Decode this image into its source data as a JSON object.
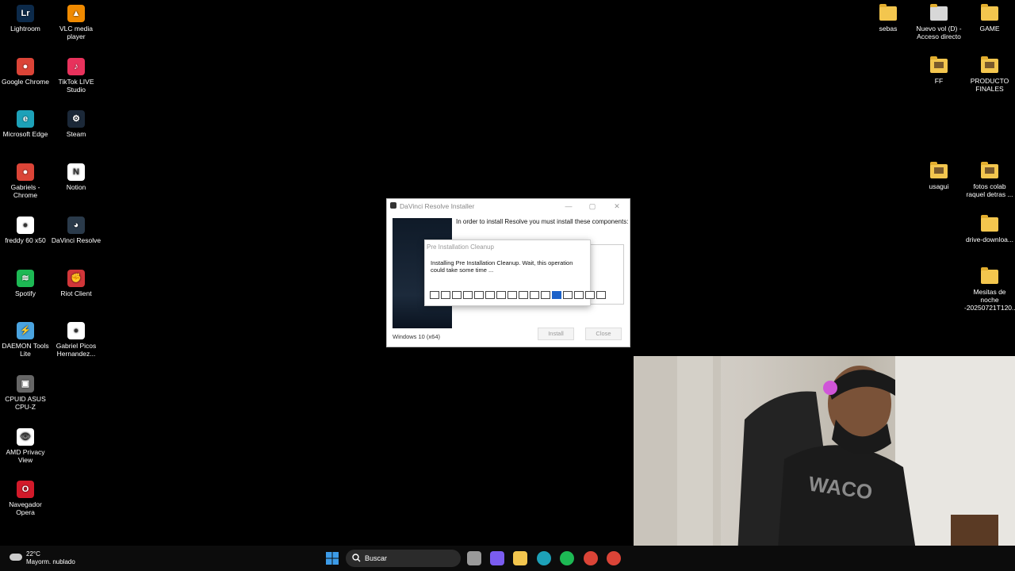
{
  "desktop_icons_left": [
    {
      "label": "Lightroom",
      "icon": "lightroom-icon",
      "color": "#0c2a4a",
      "glyph": "Lr"
    },
    {
      "label": "VLC media player",
      "icon": "vlc-icon",
      "color": "#f08a00",
      "glyph": "▲"
    },
    {
      "label": "Google Chrome",
      "icon": "chrome-icon",
      "color": "#db4437",
      "glyph": "●"
    },
    {
      "label": "TikTok LIVE Studio",
      "icon": "tiktok-live-icon",
      "color": "#e8325c",
      "glyph": "♪"
    },
    {
      "label": "Microsoft Edge",
      "icon": "edge-icon",
      "color": "#1da1b8",
      "glyph": "e"
    },
    {
      "label": "Steam",
      "icon": "steam-icon",
      "color": "#1b2838",
      "glyph": "⚙"
    },
    {
      "label": "Gabriels - Chrome",
      "icon": "chrome-profile-icon",
      "color": "#db4437",
      "glyph": "●"
    },
    {
      "label": "Notion",
      "icon": "notion-icon",
      "color": "#ffffff",
      "glyph": "N"
    },
    {
      "label": "freddy 60 x50",
      "icon": "chrome-shortcut-icon",
      "color": "#ffffff",
      "glyph": "●"
    },
    {
      "label": "DaVinci Resolve",
      "icon": "davinci-icon",
      "color": "#2a3a4a",
      "glyph": "◕"
    },
    {
      "label": "Spotify",
      "icon": "spotify-icon",
      "color": "#1db954",
      "glyph": "≋"
    },
    {
      "label": "Riot Client",
      "icon": "riot-icon",
      "color": "#d13639",
      "glyph": "✊"
    },
    {
      "label": "DAEMON Tools Lite",
      "icon": "daemon-tools-icon",
      "color": "#4aa3df",
      "glyph": "⚡"
    },
    {
      "label": "Gabriel Picos Hernandez...",
      "icon": "chrome-shortcut-icon",
      "color": "#ffffff",
      "glyph": "●"
    },
    {
      "label": "CPUID ASUS CPU-Z",
      "icon": "cpuz-icon",
      "color": "#666666",
      "glyph": "▣"
    },
    {
      "label": "AMD Privacy View",
      "icon": "amd-privacy-icon",
      "color": "#ffffff",
      "glyph": "👁"
    },
    {
      "label": "Navegador Opera",
      "icon": "opera-icon",
      "color": "#d21a2a",
      "glyph": "O"
    }
  ],
  "desktop_icons_right": [
    {
      "label": "sebas",
      "icon": "folder-icon"
    },
    {
      "label": "Nuevo vol (D) - Acceso directo",
      "icon": "drive-shortcut-icon"
    },
    {
      "label": "GAME",
      "icon": "folder-icon"
    },
    {
      "label": "FF",
      "icon": "folder-icon"
    },
    {
      "label": "PRODUCTO FINALES",
      "icon": "folder-icon"
    },
    {
      "label": "usagui",
      "icon": "folder-icon"
    },
    {
      "label": "fotos colab raquel detras ...",
      "icon": "folder-icon"
    },
    {
      "label": "drive-downloa...",
      "icon": "folder-icon"
    },
    {
      "label": "Mesitas de noche -20250721T120...",
      "icon": "folder-icon"
    }
  ],
  "installer": {
    "title": "DaVinci Resolve Installer",
    "instruction": "In order to install Resolve you must install these components:",
    "install_label": "Install",
    "close_label": "Close",
    "os_info": "Windows 10 (x64)",
    "minimize": "—",
    "maximize": "▢",
    "close_x": "✕"
  },
  "cleanup_dialog": {
    "title": "Pre Installation Cleanup",
    "message": "Installing Pre Installation Cleanup. Wait, this operation could take some time ...",
    "segments_total": 16,
    "active_segment": 11
  },
  "taskbar": {
    "temperature": "22°C",
    "condition": "Mayorm. nublado",
    "search_label": "Buscar",
    "apps": [
      {
        "name": "windows-start-icon",
        "color": "#3c9be8"
      },
      {
        "name": "task-view-icon",
        "color": "#9a9a9a"
      },
      {
        "name": "copilot-icon",
        "color": "#7a5cf0"
      },
      {
        "name": "file-explorer-icon",
        "color": "#f3c64e"
      },
      {
        "name": "edge-icon",
        "color": "#1da1b8"
      },
      {
        "name": "spotify-icon",
        "color": "#1db954"
      },
      {
        "name": "chrome-icon",
        "color": "#db4437"
      },
      {
        "name": "chrome-profile-icon",
        "color": "#db4437"
      }
    ]
  }
}
